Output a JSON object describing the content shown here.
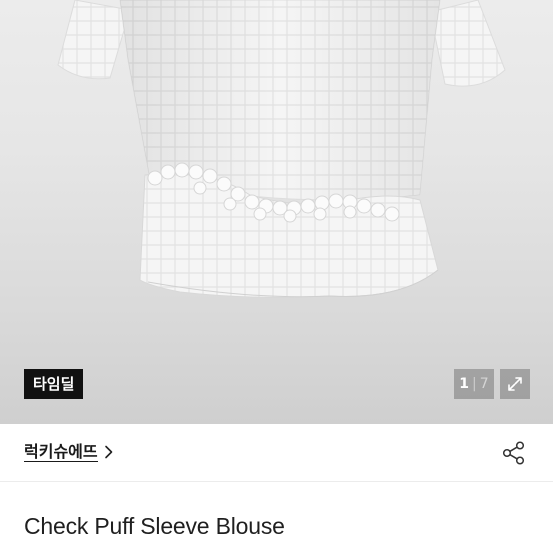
{
  "product_image": {
    "alt": "",
    "badge_text": "타임딜",
    "counter": {
      "current": "1",
      "separator": "|",
      "total": "7"
    },
    "expand_icon": "expand-arrows-icon"
  },
  "store": {
    "name": "럭키슈에뜨",
    "chevron_icon": "chevron-right-icon",
    "share_icon": "share-icon"
  },
  "product": {
    "title": "Check Puff Sleeve Blouse"
  },
  "colors": {
    "badge_bg": "#111111",
    "text_primary": "#1f1f1f",
    "divider": "#ececec"
  }
}
